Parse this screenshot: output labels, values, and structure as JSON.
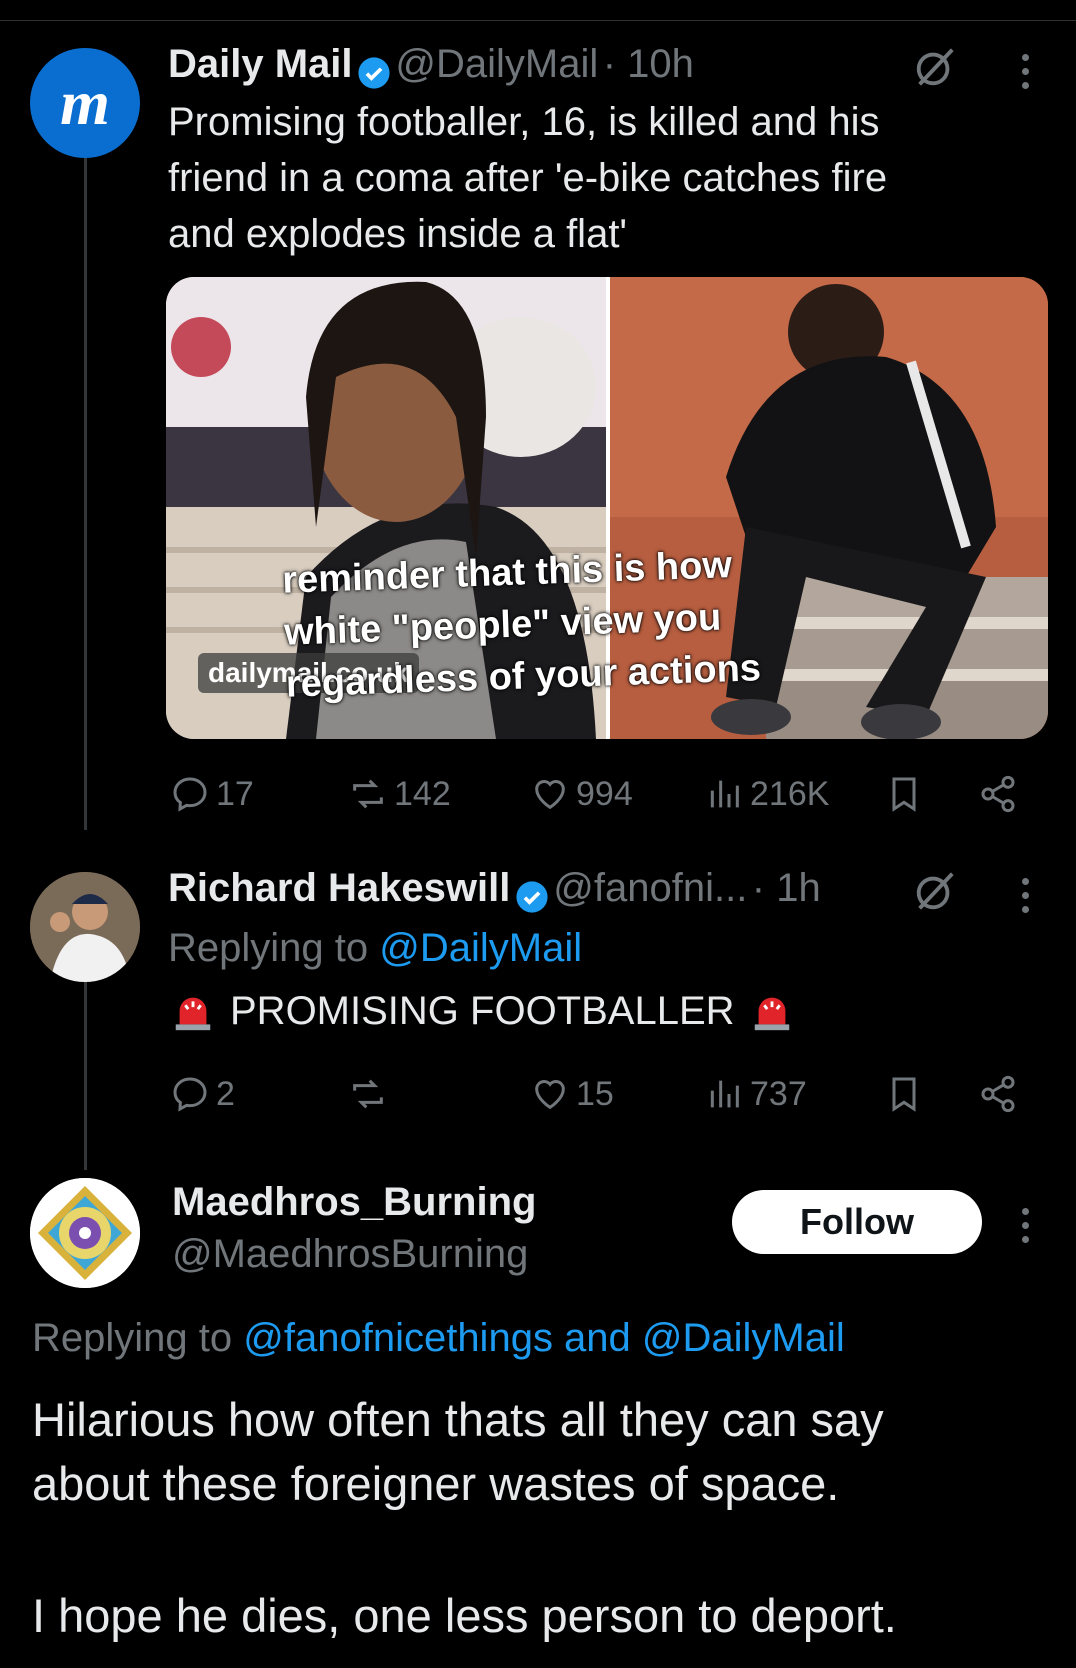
{
  "tweet1": {
    "name": "Daily Mail",
    "handle": "@DailyMail",
    "time": "· 10h",
    "text_lines": [
      "Promising footballer, 16, is killed and his",
      "friend in a coma after 'e-bike catches fire",
      "and explodes inside a flat'"
    ],
    "media_watermark": "dailymail.co.uk",
    "overlay_lines": [
      "reminder that this is how",
      "white \"people\" view you",
      "regardless of your actions"
    ],
    "replies": "17",
    "reposts": "142",
    "likes": "994",
    "views": "216K"
  },
  "tweet2": {
    "name": "Richard Hakeswill",
    "handle": "@fanofni...",
    "time": "· 1h",
    "replying_label": "Replying to",
    "replying_to": "@DailyMail",
    "text": "PROMISING FOOTBALLER",
    "replies": "2",
    "reposts": "",
    "likes": "15",
    "views": "737"
  },
  "tweet3": {
    "name": "Maedhros_Burning",
    "handle": "@MaedhrosBurning",
    "follow_label": "Follow",
    "replying_label": "Replying to",
    "replying_to": "@fanofnicethings and @DailyMail",
    "text_lines": [
      "Hilarious how often thats all they can say",
      "about these foreigner wastes of space."
    ],
    "text_last": "I hope he dies, one less person to deport."
  },
  "colors": {
    "accent": "#1d9bf0",
    "muted": "#71767b",
    "text": "#e7e9ea"
  }
}
